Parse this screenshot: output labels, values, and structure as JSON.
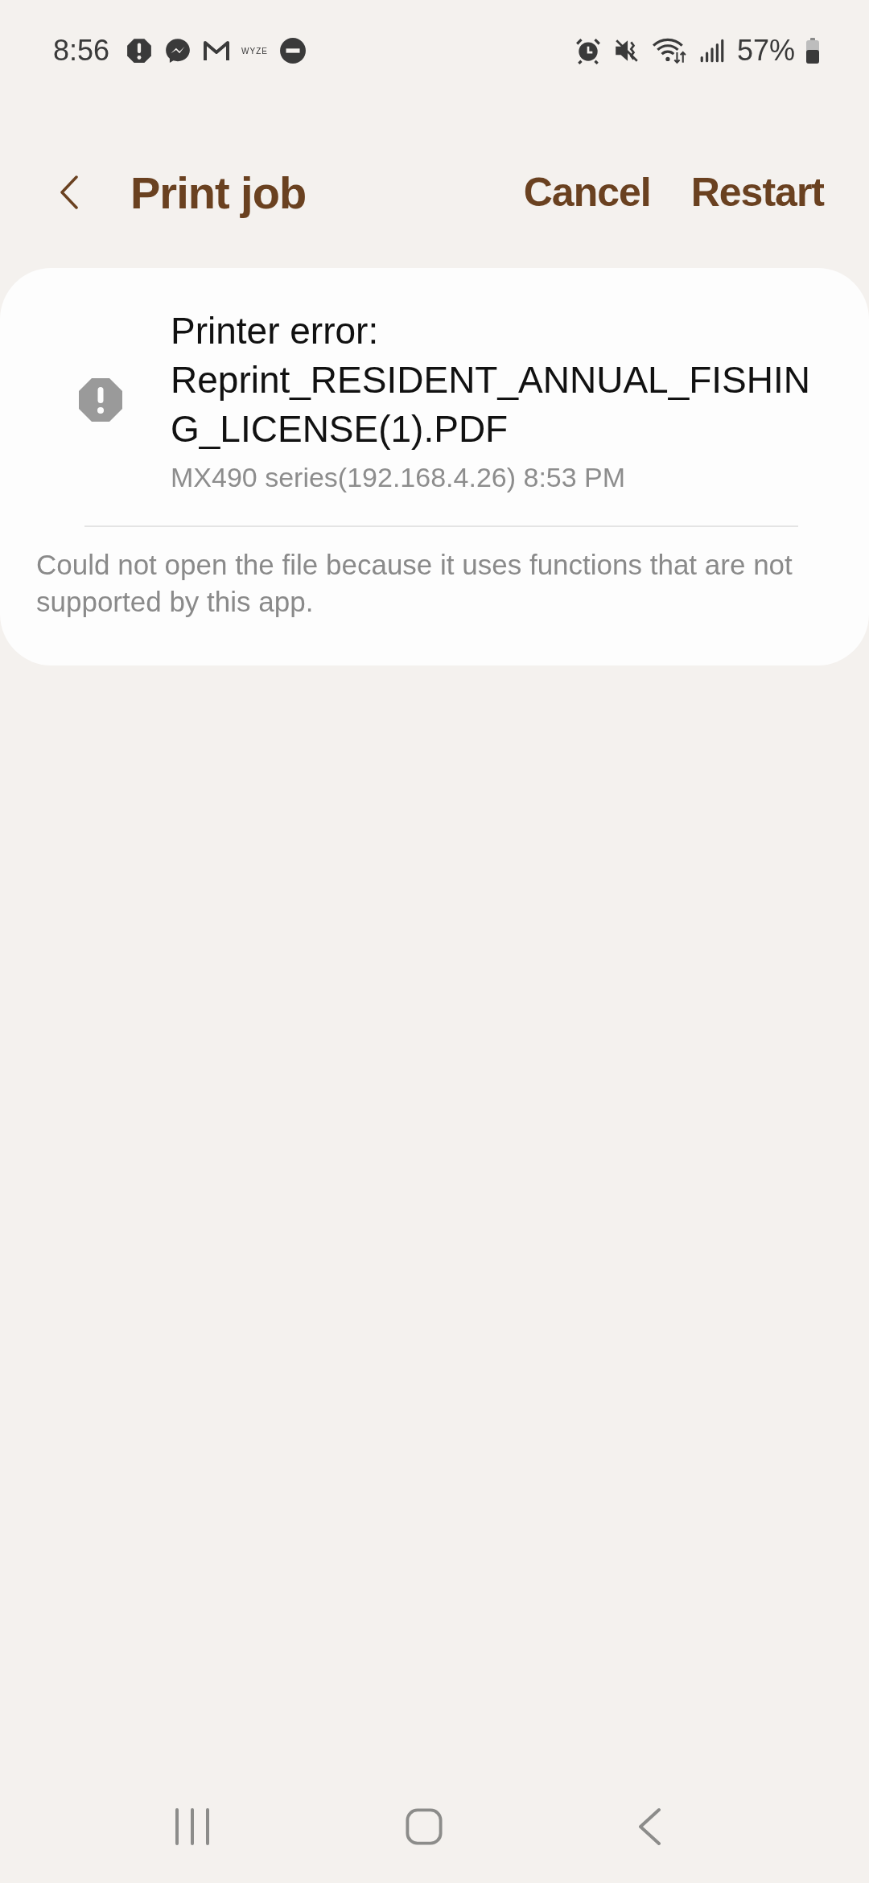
{
  "status_bar": {
    "time": "8:56",
    "notification_text": "WYZE",
    "battery": "57%"
  },
  "header": {
    "title": "Print job",
    "actions": [
      "Cancel",
      "Restart"
    ]
  },
  "job": {
    "title": "Printer error: Reprint_RESIDENT_ANNUAL_FISHING_LICENSE(1).PDF",
    "subtitle": "MX490 series(192.168.4.26) 8:53 PM",
    "message": "Could not open the file because it uses functions that are not supported by this app."
  }
}
